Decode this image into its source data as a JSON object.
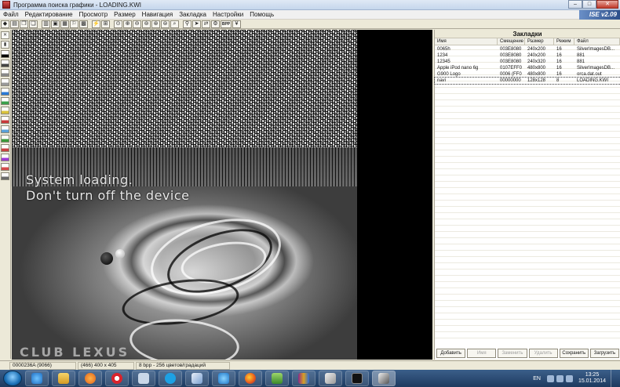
{
  "window": {
    "title": "Программа поиска графики - LOADING.KWI",
    "controls": {
      "minimize": "–",
      "maximize": "□",
      "close": "✕"
    }
  },
  "menu": {
    "items": [
      "Файл",
      "Редактирование",
      "Просмотр",
      "Размер",
      "Навигация",
      "Закладка",
      "Настройки",
      "Помощь"
    ],
    "brand": "ISE v2.09"
  },
  "toolbar": {
    "bpp_label": "BPP",
    "yen_label": "¥"
  },
  "canvas": {
    "caption_line1": "System loading.",
    "caption_line2": "Don't turn off the device",
    "logo": "CLUB LEXUS"
  },
  "bookmarks": {
    "title": "Закладки",
    "columns": [
      "Имя",
      "Смещение",
      "Размер",
      "Режим",
      "Файл"
    ],
    "rows": [
      [
        "0065h",
        "003E8080",
        "240x200",
        "16",
        "SilverImagesDB..."
      ],
      [
        "1234",
        "003E8080",
        "240x200",
        "16",
        "881"
      ],
      [
        "12345",
        "003E8080",
        "240x320",
        "16",
        "881"
      ],
      [
        "Apple iPod nano 6g",
        "0107EFF0",
        "480x800",
        "16",
        "SilverImagesDB..."
      ],
      [
        "G900 Logo",
        "0006 (FF0",
        "480x800",
        "16",
        "orca.dat.out"
      ],
      [
        "navi",
        "00000000",
        "128x128",
        "8",
        "LOADING.KWI"
      ]
    ],
    "buttons": {
      "add": "Добавить",
      "name": "Имя",
      "replace": "Заменить",
      "delete": "Удалить",
      "save": "Сохранить",
      "load": "Загрузить"
    }
  },
  "status": {
    "offset": "0000236A (9066)",
    "dims": "(466) 400 x 405",
    "mode": "8 bpp - 256 цветов/градаций"
  },
  "taskbar": {
    "lang": "EN",
    "time": "13:25",
    "date": "15.01.2014"
  },
  "colors": {
    "accent": "#2c4f8a",
    "taskbar": "#1e3a5f"
  }
}
